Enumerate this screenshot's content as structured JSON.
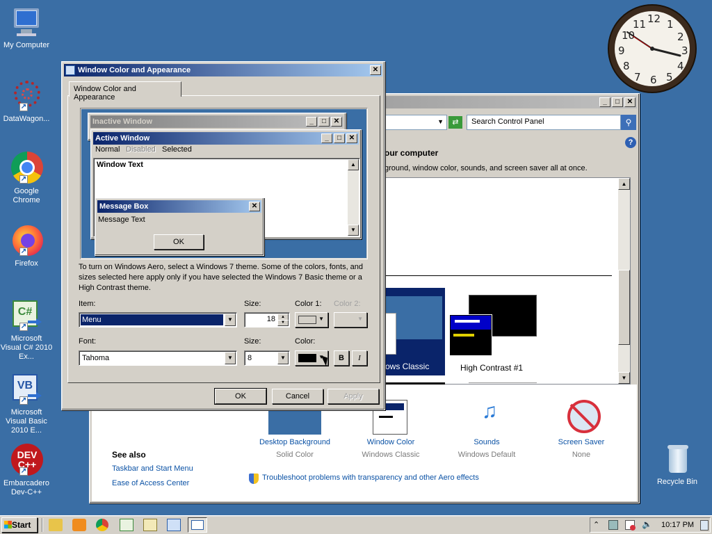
{
  "desktop": {
    "icons": [
      {
        "label": "My Computer"
      },
      {
        "label": "DataWagon..."
      },
      {
        "label": "Google Chrome"
      },
      {
        "label": "Firefox"
      },
      {
        "label": "Microsoft Visual C# 2010 Ex..."
      },
      {
        "label": "Microsoft Visual Basic 2010 E..."
      },
      {
        "label": "Embarcadero Dev-C++"
      }
    ],
    "recycle_bin": "Recycle Bin",
    "clock_numbers": [
      "12",
      "1",
      "2",
      "3",
      "4",
      "5",
      "6",
      "7",
      "8",
      "9",
      "10",
      "11"
    ]
  },
  "control_panel": {
    "search_placeholder": "Search Control Panel",
    "heading": "our computer",
    "subheading": "ground, window color, sounds, and screen saver all at once.",
    "themes": [
      {
        "label": "ows Classic"
      },
      {
        "label": "High Contrast #1"
      }
    ],
    "bottom_items": [
      {
        "title": "Desktop Background",
        "sub": "Solid Color"
      },
      {
        "title": "Window Color",
        "sub": "Windows Classic"
      },
      {
        "title": "Sounds",
        "sub": "Windows Default"
      },
      {
        "title": "Screen Saver",
        "sub": "None"
      }
    ],
    "see_also": "See also",
    "links": [
      "Taskbar and Start Menu",
      "Ease of Access Center"
    ],
    "troubleshoot": "Troubleshoot problems with transparency and other Aero effects"
  },
  "dialog": {
    "title": "Window Color and Appearance",
    "tab": "Window Color and Appearance",
    "preview": {
      "inactive_title": "Inactive Window",
      "active_title": "Active Window",
      "menu_normal": "Normal",
      "menu_disabled": "Disabled",
      "menu_selected": "Selected",
      "window_text": "Window Text",
      "msgbox_title": "Message Box",
      "msgbox_text": "Message Text",
      "ok": "OK"
    },
    "info": "To turn on Windows Aero, select a Windows 7 theme.  Some of the colors, fonts, and sizes selected here apply only if you have selected the Windows 7 Basic theme or a High Contrast theme.",
    "item_label": "Item:",
    "item_value": "Menu",
    "size_label": "Size:",
    "size_value": "18",
    "color1_label": "Color 1:",
    "color2_label": "Color 2:",
    "font_label": "Font:",
    "font_value": "Tahoma",
    "font_size_label": "Size:",
    "font_size_value": "8",
    "color_label": "Color:",
    "bold": "B",
    "italic": "I",
    "ok": "OK",
    "cancel": "Cancel",
    "apply": "Apply"
  },
  "taskbar": {
    "start": "Start",
    "time": "10:17 PM"
  },
  "colors": {
    "desktop": "#3a6ea5",
    "title_active": "#0a246a",
    "selection": "#0a246a"
  }
}
